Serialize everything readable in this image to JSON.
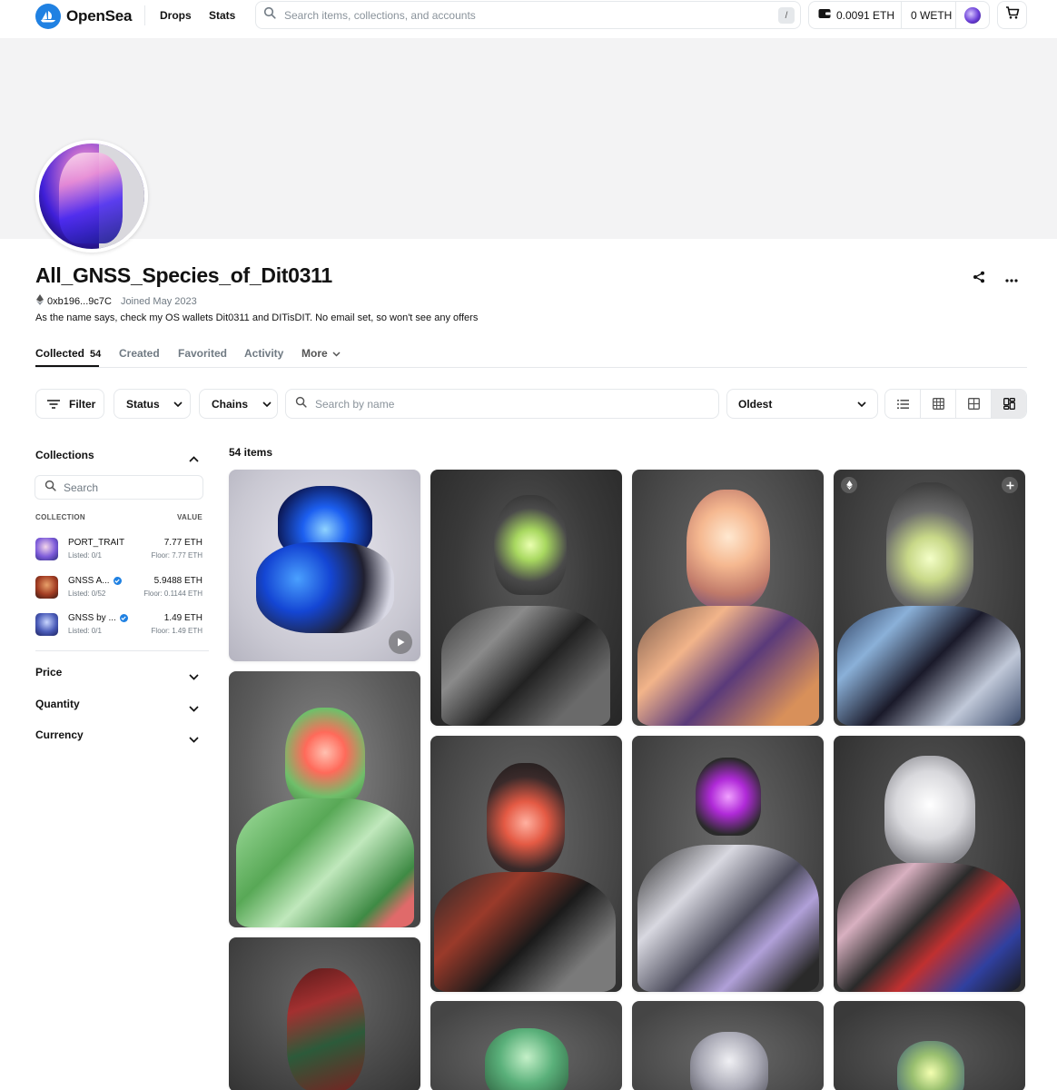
{
  "nav": {
    "brand": "OpenSea",
    "links": [
      "Drops",
      "Stats"
    ],
    "search_placeholder": "Search items, collections, and accounts",
    "search_shortcut": "/",
    "eth_balance": "0.0091 ETH",
    "weth_balance": "0 WETH"
  },
  "profile": {
    "name": "All_GNSS_Species_of_Dit0311",
    "address": "0xb196...9c7C",
    "joined": "Joined May 2023",
    "bio": "As the name says, check my OS wallets Dit0311 and DITisDIT. No email set, so won't see any offers"
  },
  "tabs": [
    {
      "label": "Collected",
      "count": "54"
    },
    {
      "label": "Created"
    },
    {
      "label": "Favorited"
    },
    {
      "label": "Activity"
    },
    {
      "label": "More"
    }
  ],
  "filters": {
    "filter_label": "Filter",
    "status_label": "Status",
    "chains_label": "Chains",
    "search_placeholder": "Search by name",
    "sort_value": "Oldest"
  },
  "sidebar": {
    "collections_title": "Collections",
    "search_placeholder": "Search",
    "col_header_collection": "COLLECTION",
    "col_header_value": "VALUE",
    "collections": [
      {
        "name": "PORT_TRAIT",
        "listed": "Listed: 0/1",
        "value": "7.77 ETH",
        "floor": "Floor: 7.77 ETH",
        "verified": false,
        "color": "#6b5ad6"
      },
      {
        "name": "GNSS A...",
        "listed": "Listed: 0/52",
        "value": "5.9488 ETH",
        "floor": "Floor: 0.1144 ETH",
        "verified": true,
        "color": "#b0442a"
      },
      {
        "name": "GNSS by ...",
        "listed": "Listed: 0/1",
        "value": "1.49 ETH",
        "floor": "Floor: 1.49 ETH",
        "verified": true,
        "color": "#4a5bb8"
      }
    ],
    "sections": [
      "Price",
      "Quantity",
      "Currency"
    ]
  },
  "grid": {
    "items_count": "54 items"
  },
  "colors": {
    "accent": "#2081e2",
    "text": "#121212",
    "muted": "#707a83",
    "border": "#e5e8eb",
    "banner": "#f3f3f4"
  }
}
